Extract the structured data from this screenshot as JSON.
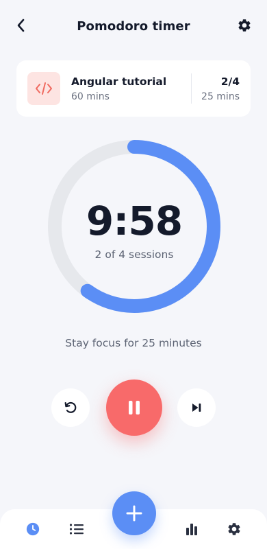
{
  "header": {
    "title": "Pomodoro timer",
    "back_icon": "chevron-left-icon",
    "settings_icon": "gear-icon"
  },
  "task": {
    "icon": "code-icon",
    "name": "Angular tutorial",
    "duration": "60 mins",
    "count": "2/4",
    "session_length": "25 mins"
  },
  "timer": {
    "time": "9:58",
    "sessions": "2 of 4 sessions",
    "progress_fraction": 0.6
  },
  "focus_message": "Stay focus for 25 minutes",
  "controls": {
    "reset_icon": "reset-icon",
    "pause_icon": "pause-icon",
    "skip_icon": "skip-next-icon"
  },
  "bottom_nav": {
    "items": [
      {
        "icon": "clock-icon",
        "active": true
      },
      {
        "icon": "list-icon",
        "active": false
      },
      {
        "icon": "bar-chart-icon",
        "active": false
      },
      {
        "icon": "gear-icon",
        "active": false
      }
    ],
    "fab_icon": "plus-icon"
  },
  "colors": {
    "accent": "#5b8ef5",
    "pause": "#f86a6a",
    "track": "#e6e8ec",
    "background": "#f5f6fa",
    "task_icon_bg": "#fde4e2",
    "task_icon_fg": "#f06a60"
  }
}
